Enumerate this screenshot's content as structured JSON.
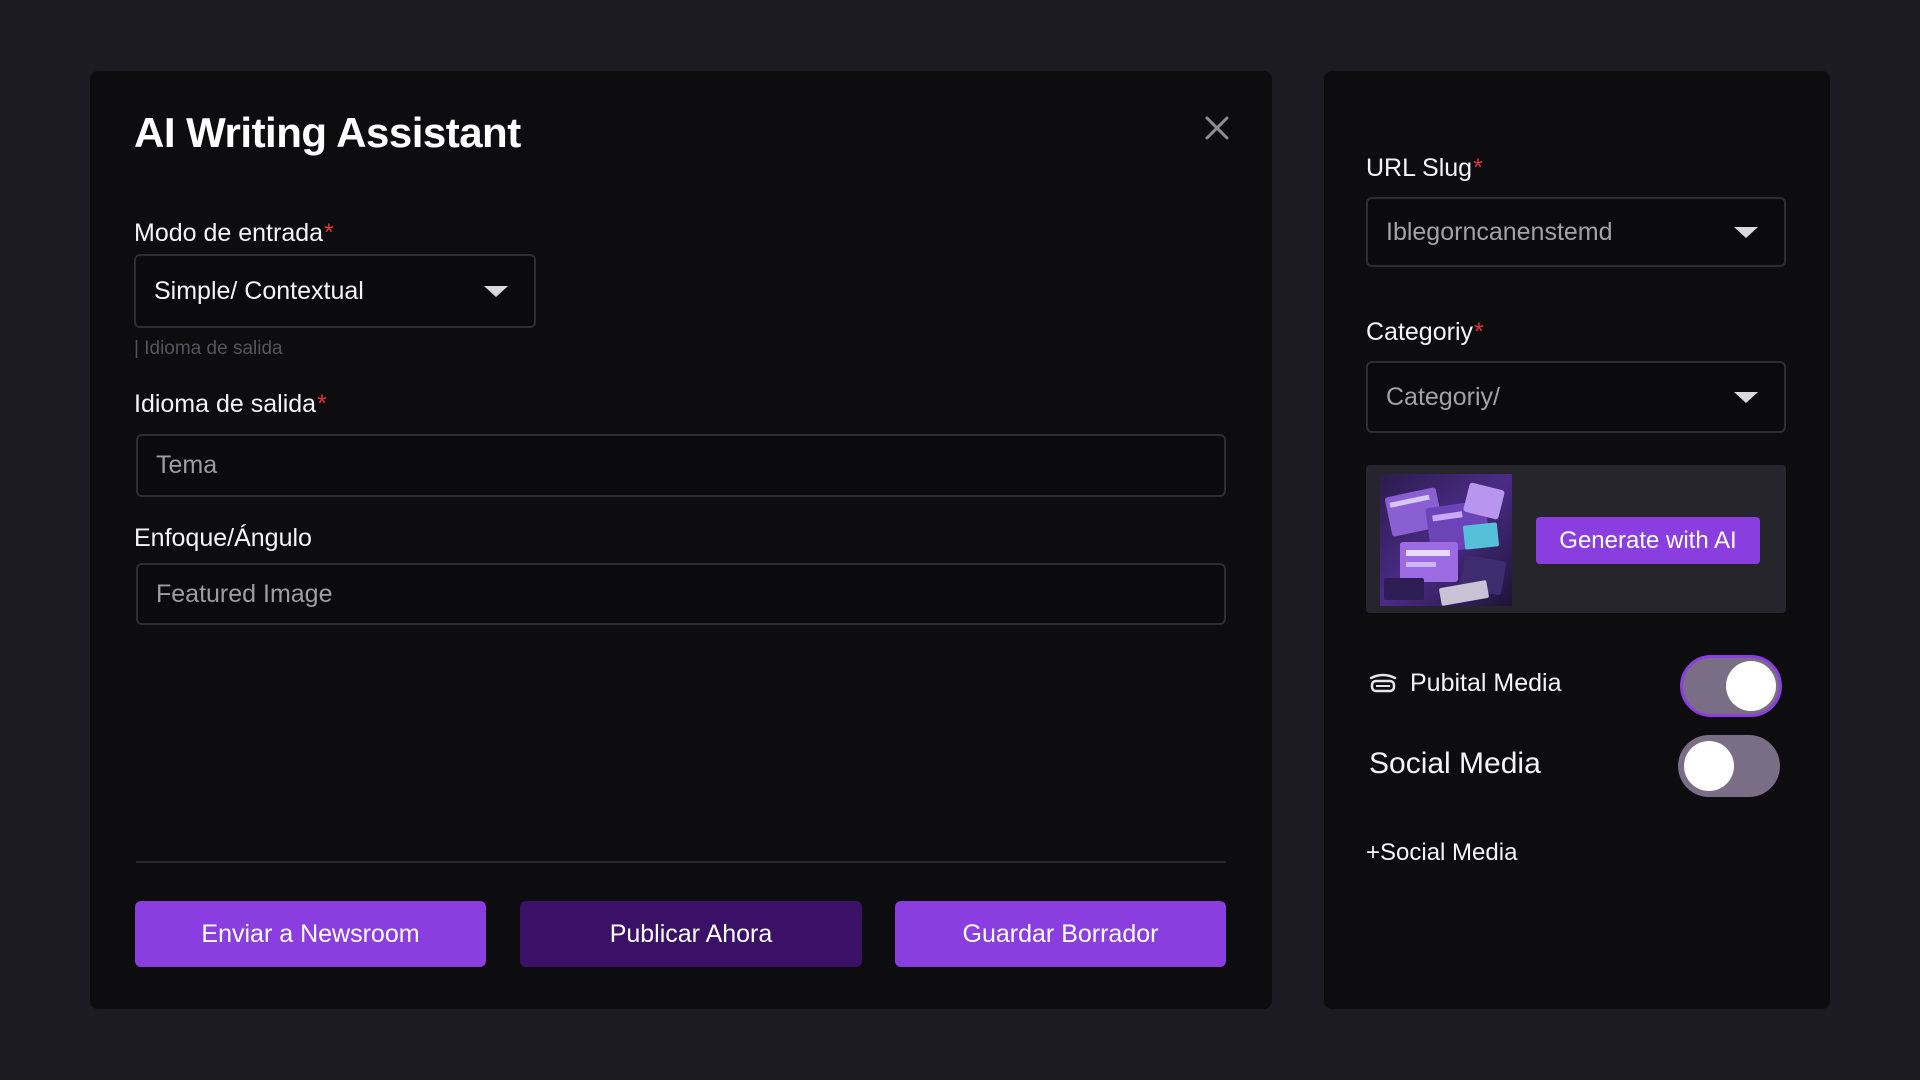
{
  "dialog": {
    "title": "AI Writing Assistant",
    "close_icon": "close-icon"
  },
  "form": {
    "modo_label": "Modo de entrada",
    "modo_value": "Simple/ Contextual",
    "hint_text": "Idioma de salida",
    "idioma_label": "Idioma de salida",
    "idioma_placeholder": "Tema",
    "enfoque_label": "Enfoque/Ángulo",
    "enfoque_placeholder": "Featured Image",
    "required_mark": "*"
  },
  "actions": {
    "send_label": "Enviar a Newsroom",
    "publish_label": "Publicar Ahora",
    "save_label": "Guardar Borrador"
  },
  "sidebar": {
    "slug_label": "URL Slug",
    "slug_value": "Iblegorncanenstemd",
    "category_label": "Categoriy",
    "category_value": "Categoriy/",
    "generate_label": "Generate with AI",
    "toggle1_label": "Pubital Media",
    "toggle1_icon": "broadcast-icon",
    "toggle1_on": true,
    "toggle2_label": "Social Media",
    "toggle2_on": false,
    "add_social_label": "Social Media",
    "add_social_prefix": "+"
  },
  "colors": {
    "accent": "#8a3ee0",
    "accent_dark": "#3a1167",
    "required": "#e5323b",
    "panel": "#0d0d0f",
    "background": "#1c1b21"
  }
}
